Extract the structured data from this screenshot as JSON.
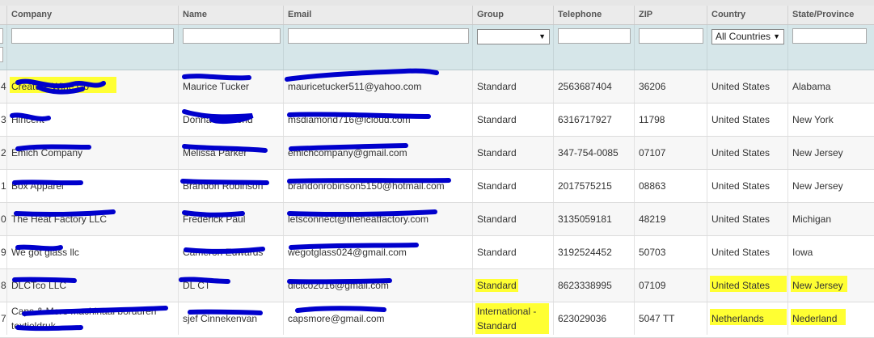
{
  "table": {
    "columns": [
      {
        "key": "id",
        "label": ""
      },
      {
        "key": "company",
        "label": "Company"
      },
      {
        "key": "name",
        "label": "Name"
      },
      {
        "key": "email",
        "label": "Email"
      },
      {
        "key": "group",
        "label": "Group"
      },
      {
        "key": "telephone",
        "label": "Telephone"
      },
      {
        "key": "zip",
        "label": "ZIP"
      },
      {
        "key": "country",
        "label": "Country"
      },
      {
        "key": "state",
        "label": "State/Province"
      }
    ],
    "filters": {
      "group_selected": "",
      "country_selected": "All Countries"
    },
    "rows": [
      {
        "id": "4",
        "company": "Creature Wine Co",
        "name": "Maurice Tucker",
        "email": "mauricetucker511@yahoo.com",
        "group": "Standard",
        "telephone": "2563687404",
        "zip": "36206",
        "country": "United States",
        "state": "Alabama"
      },
      {
        "id": "3",
        "company": "Hincent",
        "name": "Donna Diamond",
        "email": "msdiamond716@icloud.com",
        "group": "Standard",
        "telephone": "6316717927",
        "zip": "11798",
        "country": "United States",
        "state": "New York"
      },
      {
        "id": "2",
        "company": "Emich Company",
        "name": "Melissa Parker",
        "email": "emichcompany@gmail.com",
        "group": "Standard",
        "telephone": "347-754-0085",
        "zip": "07107",
        "country": "United States",
        "state": "New Jersey"
      },
      {
        "id": "1",
        "company": "Box Apparel",
        "name": "Brandon Robinson",
        "email": "brandonrobinson5150@hotmail.com",
        "group": "Standard",
        "telephone": "2017575215",
        "zip": "08863",
        "country": "United States",
        "state": "New Jersey"
      },
      {
        "id": "0",
        "company": "The Heat Factory LLC",
        "name": "Frederick Paul",
        "email": "letsconnect@theheatfactory.com",
        "group": "Standard",
        "telephone": "3135059181",
        "zip": "48219",
        "country": "United States",
        "state": "Michigan"
      },
      {
        "id": "9",
        "company": "We got glass llc",
        "name": "Cameron Edwards",
        "email": "wegotglass024@gmail.com",
        "group": "Standard",
        "telephone": "3192524452",
        "zip": "50703",
        "country": "United States",
        "state": "Iowa"
      },
      {
        "id": "8",
        "company": "DLCTco LLC",
        "name": "DL CT",
        "email": "dlctco2016@gmail.com",
        "group": "Standard",
        "telephone": "8623338995",
        "zip": "07109",
        "country": "United States",
        "state": "New Jersey"
      },
      {
        "id": "7",
        "company": "Caps & More machinaal borduren textieldruk",
        "name": "sjef Cinnekenvan",
        "email": "capsmore@gmail.com",
        "group": "International - Standard",
        "telephone": "623029036",
        "zip": "5047 TT",
        "country": "Netherlands",
        "state": "Nederland"
      }
    ]
  },
  "colors": {
    "highlight": "#ffff33",
    "redaction": "#0000cc",
    "filter_band": "#d6e6e9",
    "header_bg": "#ebebeb"
  }
}
